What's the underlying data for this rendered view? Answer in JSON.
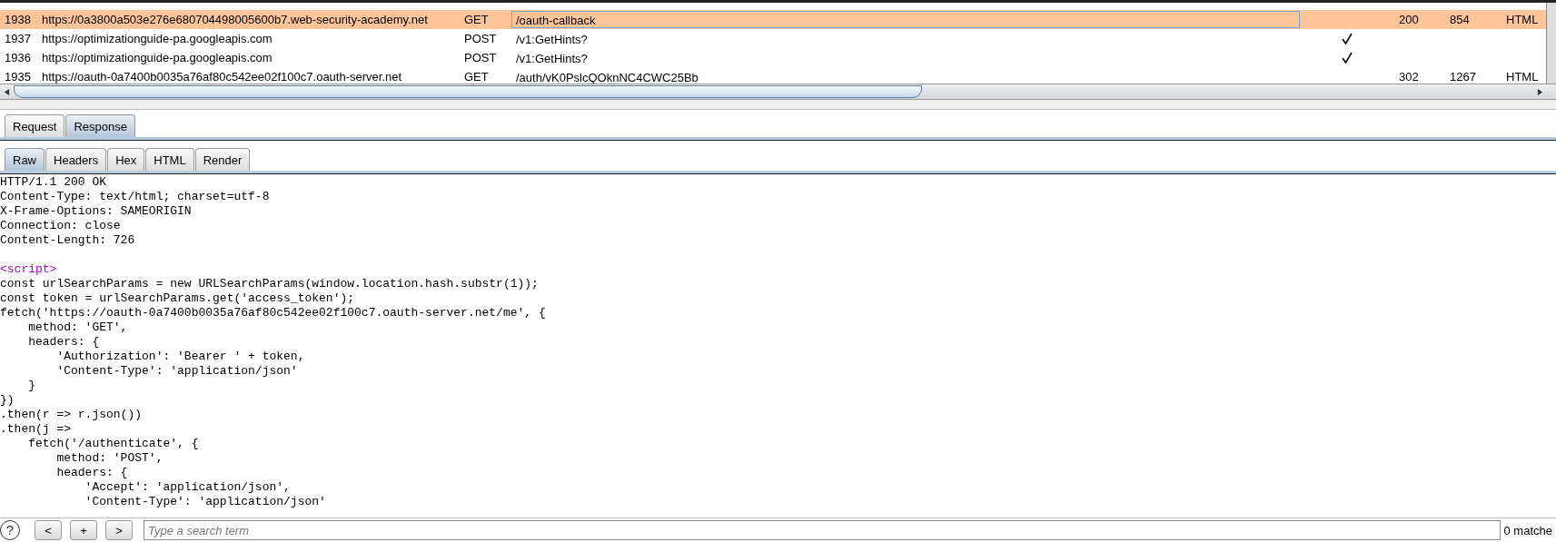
{
  "history": {
    "rows": [
      {
        "number": "1938",
        "host": "https://0a3800a503e276e680704498005600b7.web-security-academy.net",
        "method": "GET",
        "path": "/oauth-callback",
        "checked": false,
        "status": "200",
        "length": "854",
        "mime": "HTML",
        "selected": true
      },
      {
        "number": "1937",
        "host": "https://optimizationguide-pa.googleapis.com",
        "method": "POST",
        "path": "/v1:GetHints?",
        "checked": true,
        "status": "",
        "length": "",
        "mime": "",
        "selected": false
      },
      {
        "number": "1936",
        "host": "https://optimizationguide-pa.googleapis.com",
        "method": "POST",
        "path": "/v1:GetHints?",
        "checked": true,
        "status": "",
        "length": "",
        "mime": "",
        "selected": false
      },
      {
        "number": "1935",
        "host": "https://oauth-0a7400b0035a76af80c542ee02f100c7.oauth-server.net",
        "method": "GET",
        "path": "/auth/vK0PslcQOknNC4CWC25Bb",
        "checked": false,
        "status": "302",
        "length": "1267",
        "mime": "HTML",
        "selected": false
      }
    ]
  },
  "tabs": [
    {
      "label": "Request",
      "selected": false
    },
    {
      "label": "Response",
      "selected": true
    }
  ],
  "view_tabs": [
    {
      "label": "Raw",
      "selected": true
    },
    {
      "label": "Headers",
      "selected": false
    },
    {
      "label": "Hex",
      "selected": false
    },
    {
      "label": "HTML",
      "selected": false
    },
    {
      "label": "Render",
      "selected": false
    }
  ],
  "response_lines": [
    {
      "kind": "header",
      "text": "HTTP/1.1 200 OK"
    },
    {
      "kind": "header",
      "text": "Content-Type: text/html; charset=utf-8"
    },
    {
      "kind": "header",
      "text": "X-Frame-Options: SAMEORIGIN"
    },
    {
      "kind": "header",
      "text": "Connection: close"
    },
    {
      "kind": "header",
      "text": "Content-Length: 726"
    },
    {
      "kind": "blank"
    },
    {
      "kind": "tag",
      "text": "<script>"
    },
    {
      "kind": "code",
      "text": "const urlSearchParams = new URLSearchParams(window.location.hash.substr(1));"
    },
    {
      "kind": "code",
      "text": "const token = urlSearchParams.get('access_token');"
    },
    {
      "kind": "code",
      "text": "fetch('https://oauth-0a7400b0035a76af80c542ee02f100c7.oauth-server.net/me', {"
    },
    {
      "kind": "code",
      "text": "    method: 'GET',"
    },
    {
      "kind": "code",
      "text": "    headers: {"
    },
    {
      "kind": "code",
      "text": "        'Authorization': 'Bearer ' + token,"
    },
    {
      "kind": "code",
      "text": "        'Content-Type': 'application/json'"
    },
    {
      "kind": "code",
      "text": "    }"
    },
    {
      "kind": "code",
      "text": "})"
    },
    {
      "kind": "code",
      "text": ".then(r => r.json())"
    },
    {
      "kind": "code",
      "text": ".then(j =>"
    },
    {
      "kind": "code",
      "text": "    fetch('/authenticate', {"
    },
    {
      "kind": "code",
      "text": "        method: 'POST',"
    },
    {
      "kind": "code",
      "text": "        headers: {"
    },
    {
      "kind": "code",
      "text": "            'Accept': 'application/json',"
    },
    {
      "kind": "code",
      "text": "            'Content-Type': 'application/json'"
    }
  ],
  "search": {
    "help": "?",
    "buttons": [
      "<",
      "+",
      ">"
    ],
    "placeholder": "Type a search term",
    "matches": "0 matche"
  }
}
